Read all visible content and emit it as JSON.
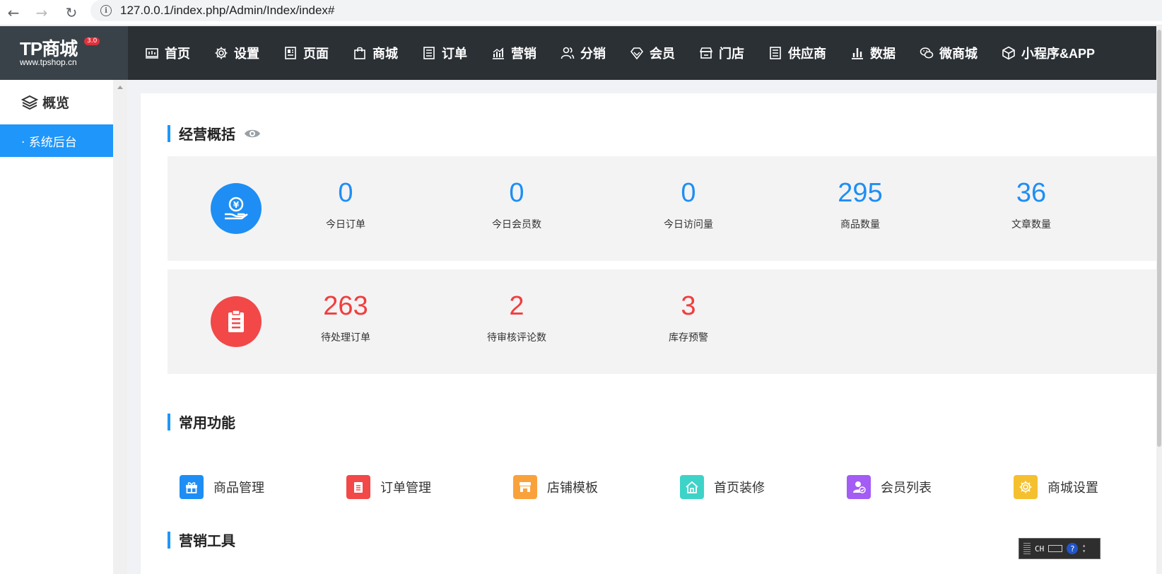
{
  "browser": {
    "url": "127.0.0.1/index.php/Admin/Index/index#",
    "back_icon": "←",
    "forward_icon": "→",
    "reload_icon": "↻",
    "info_icon": "i"
  },
  "logo": {
    "main": "TP商城",
    "version": "3.0",
    "sub": "www.tpshop.cn"
  },
  "top_nav": [
    {
      "label": "首页",
      "icon": "dashboard-icon"
    },
    {
      "label": "设置",
      "icon": "gear-icon"
    },
    {
      "label": "页面",
      "icon": "page-icon"
    },
    {
      "label": "商城",
      "icon": "bag-icon"
    },
    {
      "label": "订单",
      "icon": "list-icon"
    },
    {
      "label": "营销",
      "icon": "chart-icon"
    },
    {
      "label": "分销",
      "icon": "users-icon"
    },
    {
      "label": "会员",
      "icon": "diamond-icon"
    },
    {
      "label": "门店",
      "icon": "store-icon"
    },
    {
      "label": "供应商",
      "icon": "list-icon"
    },
    {
      "label": "数据",
      "icon": "bar-chart-icon"
    },
    {
      "label": "微商城",
      "icon": "wechat-icon"
    },
    {
      "label": "小程序&APP",
      "icon": "cube-icon"
    }
  ],
  "sidebar": {
    "title": "概览",
    "items": [
      {
        "label": "· 系统后台"
      }
    ]
  },
  "overview": {
    "title": "经营概括",
    "row1": [
      {
        "value": "0",
        "label": "今日订单"
      },
      {
        "value": "0",
        "label": "今日会员数"
      },
      {
        "value": "0",
        "label": "今日访问量"
      },
      {
        "value": "295",
        "label": "商品数量"
      },
      {
        "value": "36",
        "label": "文章数量"
      }
    ],
    "row2": [
      {
        "value": "263",
        "label": "待处理订单"
      },
      {
        "value": "2",
        "label": "待审核评论数"
      },
      {
        "value": "3",
        "label": "库存预警"
      }
    ],
    "row1_color": "#1e8ef4",
    "row2_color": "#f23d3d"
  },
  "common": {
    "title": "常用功能",
    "items": [
      {
        "label": "商品管理",
        "color": "#1e8ef4",
        "icon": "gift-icon"
      },
      {
        "label": "订单管理",
        "color": "#f24848",
        "icon": "clipboard-icon"
      },
      {
        "label": "店铺模板",
        "color": "#f9a23c",
        "icon": "shop-icon"
      },
      {
        "label": "首页装修",
        "color": "#3ed3c8",
        "icon": "home-icon"
      },
      {
        "label": "会员列表",
        "color": "#a35cf4",
        "icon": "user-check-icon"
      },
      {
        "label": "商城设置",
        "color": "#f5c02f",
        "icon": "gear-icon"
      }
    ]
  },
  "marketing": {
    "title": "营销工具"
  },
  "ime": {
    "lang": "CH",
    "help": "?"
  }
}
